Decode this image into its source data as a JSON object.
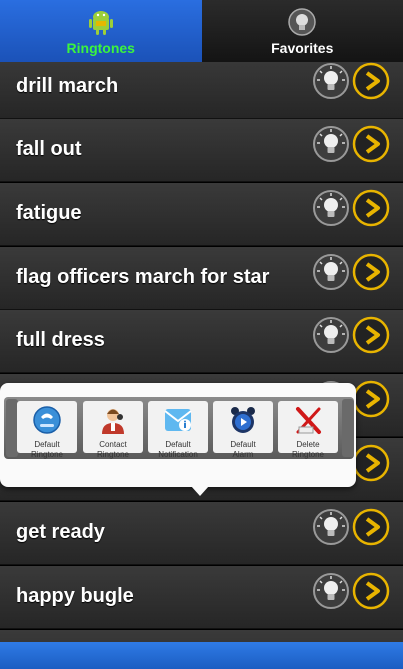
{
  "tabs": [
    {
      "label": "Ringtones",
      "icon": "android-icon",
      "active": true
    },
    {
      "label": "Favorites",
      "icon": "bulb-icon",
      "active": false
    }
  ],
  "ringtones": [
    {
      "name": "drill march"
    },
    {
      "name": "fall out"
    },
    {
      "name": "fatigue"
    },
    {
      "name": "flag officers march for star"
    },
    {
      "name": "full dress"
    },
    {
      "name": ""
    },
    {
      "name": ""
    },
    {
      "name": "get ready"
    },
    {
      "name": "happy bugle"
    }
  ],
  "quick_actions": [
    {
      "line1": "Default",
      "line2": "Ringtone",
      "icon": "phone-globe-icon"
    },
    {
      "line1": "Contact",
      "line2": "Ringtone",
      "icon": "contact-person-icon"
    },
    {
      "line1": "Default",
      "line2": "Notification",
      "icon": "notification-info-icon"
    },
    {
      "line1": "Default",
      "line2": "Alarm",
      "icon": "alarm-clock-icon"
    },
    {
      "line1": "Delete",
      "line2": "Ringtone",
      "icon": "delete-x-icon"
    }
  ],
  "colors": {
    "tab_active_bg": "#1f5ec8",
    "tab_active_text": "#3cf53c",
    "row_bg": "#303030",
    "play_gold": "#e8b400",
    "bottom_bar": "#2a72e0"
  }
}
